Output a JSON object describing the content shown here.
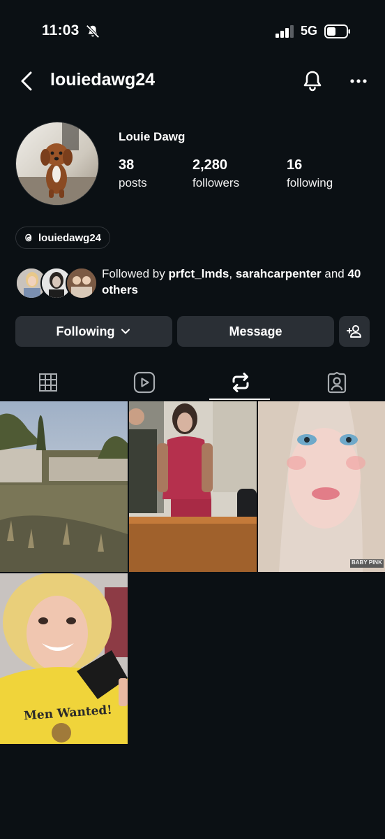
{
  "status_bar": {
    "time": "11:03",
    "network": "5G",
    "icons": [
      "bell-slash-icon",
      "signal-icon",
      "battery-icon"
    ]
  },
  "header": {
    "username": "louiedawg24",
    "icons": [
      "back-chevron-icon",
      "bell-icon",
      "more-dots-icon"
    ]
  },
  "profile": {
    "full_name": "Louie Dawg",
    "stats": [
      {
        "number": "38",
        "label": "posts"
      },
      {
        "number": "2,280",
        "label": "followers"
      },
      {
        "number": "16",
        "label": "following"
      }
    ],
    "threads_handle": "louiedawg24"
  },
  "followed_by": {
    "prefix": "Followed by ",
    "users": [
      "prfct_lmds",
      "sarahcarpenter"
    ],
    "separator": ", ",
    "conjunction": " and ",
    "others": "40 others"
  },
  "actions": {
    "following_label": "Following",
    "message_label": "Message"
  },
  "tabs": [
    {
      "name": "posts-grid-tab",
      "icon": "grid-icon",
      "selected": false
    },
    {
      "name": "reels-tab",
      "icon": "reels-icon",
      "selected": false
    },
    {
      "name": "reposts-tab",
      "icon": "repost-icon",
      "selected": true
    },
    {
      "name": "tagged-tab",
      "icon": "tagged-person-icon",
      "selected": false
    }
  ],
  "grid": {
    "watermark": "BABY PINK",
    "shirt_text": "Men Wanted!"
  },
  "colors": {
    "background": "#0b1014",
    "button": "#2a2f35",
    "text": "#ffffff"
  }
}
